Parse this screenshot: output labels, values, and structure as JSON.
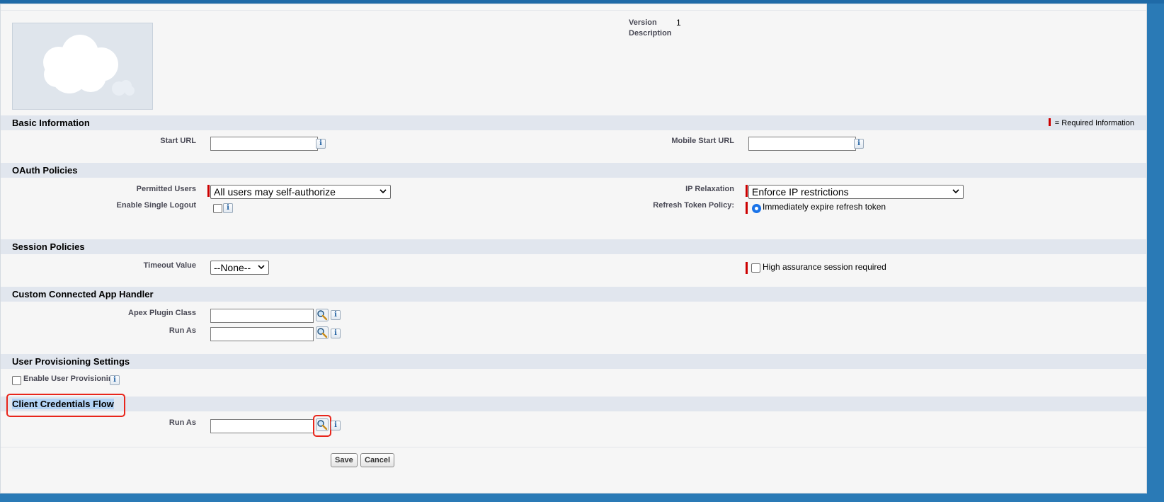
{
  "header": {
    "version_label": "Version",
    "version_value": "1",
    "description_label": "Description"
  },
  "sections": {
    "basic": {
      "title": "Basic Information",
      "required_legend": "= Required Information",
      "start_url_label": "Start URL",
      "start_url_value": "",
      "mobile_start_url_label": "Mobile Start URL",
      "mobile_start_url_value": ""
    },
    "oauth": {
      "title": "OAuth Policies",
      "permitted_users_label": "Permitted Users",
      "permitted_users_value": "All users may self-authorize",
      "ip_relaxation_label": "IP Relaxation",
      "ip_relaxation_value": "Enforce IP restrictions",
      "single_logout_label": "Enable Single Logout",
      "refresh_token_label": "Refresh Token Policy:",
      "refresh_token_option": "Immediately expire refresh token"
    },
    "session": {
      "title": "Session Policies",
      "timeout_label": "Timeout Value",
      "timeout_value": "--None--",
      "high_assurance_label": "High assurance session required"
    },
    "handler": {
      "title": "Custom Connected App Handler",
      "apex_plugin_label": "Apex Plugin Class",
      "run_as_label": "Run As"
    },
    "provisioning": {
      "title": "User Provisioning Settings",
      "enable_label": "Enable User Provisioning"
    },
    "client_credentials": {
      "title": "Client Credentials Flow",
      "run_as_label": "Run As"
    }
  },
  "buttons": {
    "save": "Save",
    "cancel": "Cancel"
  },
  "icons": {
    "info": "i",
    "lookup": "magnifier-lookup-icon",
    "info_glyph_name": "info-icon"
  },
  "colors": {
    "required_bar": "#cc0000",
    "section_bar": "#e1e6ee",
    "highlight": "#e8251b"
  }
}
